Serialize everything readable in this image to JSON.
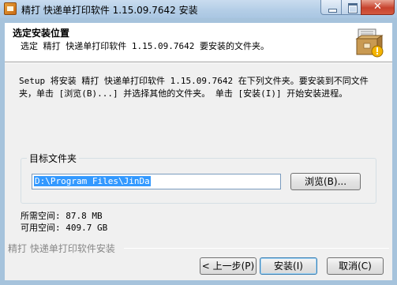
{
  "window": {
    "title": "精打 快递单打印软件 1.15.09.7642 安装",
    "close_glyph": "✕"
  },
  "header": {
    "title": "选定安装位置",
    "subtitle": "选定 精打 快递单打印软件 1.15.09.7642 要安装的文件夹。",
    "icon": "installer-box-icon"
  },
  "body": {
    "description": "Setup 将安装 精打 快递单打印软件 1.15.09.7642 在下列文件夹。要安装到不同文件夹，单击 [浏览(B)...] 并选择其他的文件夹。 单击 [安装(I)] 开始安装进程。",
    "group_label": "目标文件夹",
    "path_value": "D:\\Program Files\\JinDa",
    "browse_label": "浏览(B)...",
    "space_required": "所需空间: 87.8 MB",
    "space_available": "可用空间: 409.7 GB"
  },
  "footer": {
    "brand": "精打 快递单打印软件安装",
    "back_label": "< 上一步(P)",
    "install_label": "安装(I)",
    "cancel_label": "取消(C)"
  },
  "colors": {
    "titlebar": "#b3cde6",
    "dialog_bg": "#f0f0f0",
    "selection": "#3399ff",
    "close_button": "#c7422e"
  }
}
